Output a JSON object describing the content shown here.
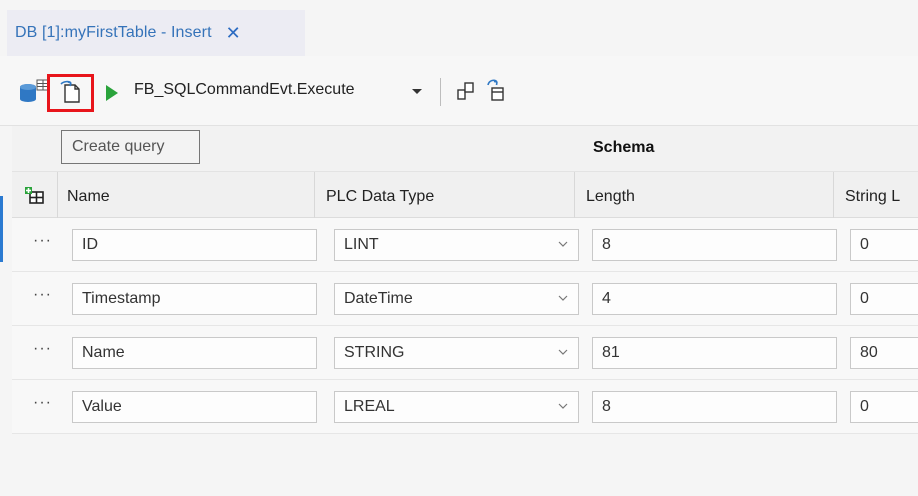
{
  "tab": {
    "title": "DB [1]:myFirstTable - Insert",
    "close_glyph": "✕"
  },
  "toolbar": {
    "command_label": "FB_SQLCommandEvt.Execute",
    "icons": [
      "database-table-icon",
      "create-query-icon",
      "run-icon",
      "chevron-down-icon",
      "copy-structure-icon",
      "refresh-structure-icon"
    ],
    "highlight_color": "#e8151b",
    "run_color": "#2aa33b"
  },
  "tooltip": {
    "text": "Create query"
  },
  "table": {
    "group_header": "Schema",
    "columns": [
      "Name",
      "PLC Data Type",
      "Length",
      "String L"
    ],
    "rows": [
      {
        "name": "ID",
        "type": "LINT",
        "length": "8",
        "string_length": "0"
      },
      {
        "name": "Timestamp",
        "type": "DateTime",
        "length": "4",
        "string_length": "0"
      },
      {
        "name": "Name",
        "type": "STRING",
        "length": "81",
        "string_length": "80"
      },
      {
        "name": "Value",
        "type": "LREAL",
        "length": "8",
        "string_length": "0"
      }
    ],
    "row_menu_glyph": "···"
  }
}
